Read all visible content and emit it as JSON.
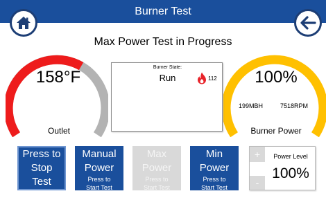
{
  "header": {
    "title": "Burner Test"
  },
  "nav": {
    "home_icon": "home-icon",
    "back_icon": "arrow-left-icon"
  },
  "subtitle": "Max Power Test in Progress",
  "outlet_gauge": {
    "value": "158°F",
    "label": "Outlet",
    "fill_fraction": 0.6,
    "active_color": "#ee1c1c",
    "track_color": "#b3b3b3"
  },
  "power_gauge": {
    "value": "100%",
    "mbh": "199MBH",
    "rpm": "7518RPM",
    "label": "Burner Power",
    "fill_fraction": 1.0,
    "active_color": "#ffc000"
  },
  "burner_state": {
    "label": "Burner State:",
    "value": "Run",
    "flame_icon": "flame-icon",
    "flame_value": "112",
    "flame_color": "#e8232a"
  },
  "buttons": {
    "stop": {
      "label_line1": "Press to",
      "label_line2": "Stop",
      "label_line3": "Test"
    },
    "manual": {
      "label_line1": "Manual",
      "label_line2": "Power",
      "sub_line1": "Press to",
      "sub_line2": "Start Test"
    },
    "max": {
      "label_line1": "Max",
      "label_line2": "Power",
      "sub_line1": "Press to",
      "sub_line2": "Start Test"
    },
    "min": {
      "label_line1": "Min",
      "label_line2": "Power",
      "sub_line1": "Press to",
      "sub_line2": "Start Test"
    }
  },
  "power_level": {
    "plus": "+",
    "minus": "-",
    "title": "Power Level",
    "value": "100%"
  },
  "colors": {
    "brand_blue": "#1a4f9c",
    "disabled_gray": "#d9d9d9"
  }
}
